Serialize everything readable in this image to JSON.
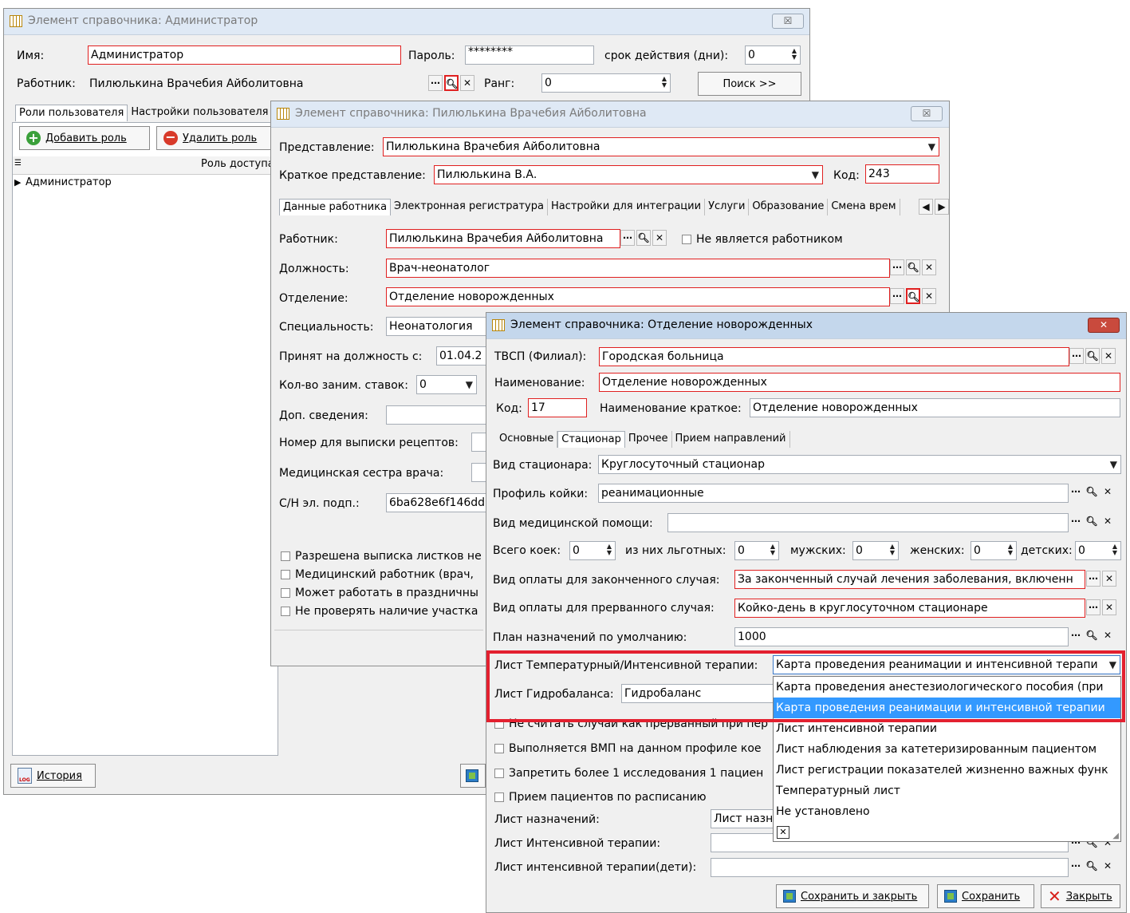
{
  "win1": {
    "title": "Элемент справочника: Администратор",
    "close": "☒",
    "name_label": "Имя:",
    "name_value": "Администратор",
    "password_label": "Пароль:",
    "password_value": "********",
    "validity_label": "срок действия (дни):",
    "validity_value": "0",
    "worker_label": "Работник:",
    "worker_value": "Пилюлькина Врачебия Айболитовна",
    "rank_label": "Ранг:",
    "rank_value": "0",
    "search_button": "Поиск >>",
    "tabs": [
      "Роли пользователя",
      "Настройки пользователя"
    ],
    "add_role": "Добавить роль",
    "delete_role": "Удалить роль",
    "grid_header": "Роль доступа",
    "grid_rows": [
      "Администратор"
    ],
    "history_button": "История"
  },
  "win2": {
    "title": "Элемент справочника: Пилюлькина Врачебия Айболитовна",
    "close": "☒",
    "repr_label": "Представление:",
    "repr_value": "Пилюлькина Врачебия Айболитовна",
    "short_label": "Краткое представление:",
    "short_value": "Пилюлькина В.А.",
    "code_label": "Код:",
    "code_value": "243",
    "tabs": [
      "Данные работника",
      "Электронная регистратура",
      "Настройки для интеграции",
      "Услуги",
      "Образование",
      "Смена врем"
    ],
    "worker_label": "Работник:",
    "worker_value": "Пилюлькина Врачебия Айболитовна",
    "not_worker": "Не является работником",
    "position_label": "Должность:",
    "position_value": "Врач-неонатолог",
    "dept_label": "Отделение:",
    "dept_value": "Отделение новорожденных",
    "spec_label": "Специальность:",
    "spec_value": "Неонатология",
    "hired_label": "Принят на должность с:",
    "hired_value": "01.04.2",
    "rates_label": "Кол-во заним. ставок:",
    "rates_value": "0",
    "extra_label": "Доп. сведения:",
    "recipe_label": "Номер для выписки рецептов:",
    "nurse_label": "Медицинская сестра врача:",
    "sign_label": "С/Н эл. подп.:",
    "sign_value": "6ba628e6f146dd",
    "checks": [
      "Разрешена выписка листков не",
      "Медицинский работник (врач,",
      "Может работать в праздничны",
      "Не проверять наличие участка"
    ]
  },
  "win3": {
    "title": "Элемент справочника: Отделение новорожденных",
    "close": "✕",
    "tvsp_label": "ТВСП (Филиал):",
    "tvsp_value": "Городская больница",
    "name_label": "Наименование:",
    "name_value": "Отделение новорожденных",
    "code_label": "Код:",
    "code_value": "17",
    "short_label": "Наименование краткое:",
    "short_value": "Отделение новорожденных",
    "tabs": [
      "Основные",
      "Стационар",
      "Прочее",
      "Прием направлений"
    ],
    "hosp_type_label": "Вид стационара:",
    "hosp_type_value": "Круглосуточный стационар",
    "bed_profile_label": "Профиль койки:",
    "bed_profile_value": "реанимационные",
    "care_label": "Вид медицинской помощи:",
    "beds_total_label": "Всего коек:",
    "beds_total": "0",
    "beds_priv_label": "из них льготных:",
    "beds_priv": "0",
    "beds_male_label": "мужских:",
    "beds_male": "0",
    "beds_female_label": "женских:",
    "beds_female": "0",
    "beds_child_label": "детских:",
    "beds_child": "0",
    "pay_done_label": "Вид оплаты для законченного случая:",
    "pay_done_value": "За законченный случай лечения заболевания, включенн",
    "pay_broken_label": "Вид оплаты для прерванного случая:",
    "pay_broken_value": "Койко-день в круглосуточном стационаре",
    "plan_label": "План назначений по умолчанию:",
    "plan_value": "1000",
    "temp_label": "Лист Температурный/Интенсивной терапии:",
    "temp_value": "Карта проведения реанимации и интенсивной терапи",
    "hydro_label": "Лист Гидробаланса:",
    "hydro_value": "Гидробаланс",
    "check_broken": "Не считать случаи как прерванный при пер",
    "check_vmp": "Выполняется ВМП на данном профиле кое",
    "check_forbid": "Запретить более 1 исследования 1 пациен",
    "check_sched": "Прием пациентов по расписанию",
    "rx_label": "Лист назначений:",
    "rx_value": "Лист назн",
    "intens_label": "Лист Интенсивной терапии:",
    "intens_child_label": "Лист интенсивной терапии(дети):",
    "save_close": "Сохранить и закрыть",
    "save": "Сохранить",
    "close_btn": "Закрыть",
    "dropdown_options": [
      "Карта проведения анестезиологического пособия (при",
      "Карта проведения реанимации и интенсивной терапии",
      "Лист интенсивной терапии",
      "Лист наблюдения за катетеризированным пациентом",
      "Лист регистрации показателей жизненно важных функ",
      "Температурный лист",
      "Не установлено"
    ],
    "dropdown_selected_index": 1
  }
}
